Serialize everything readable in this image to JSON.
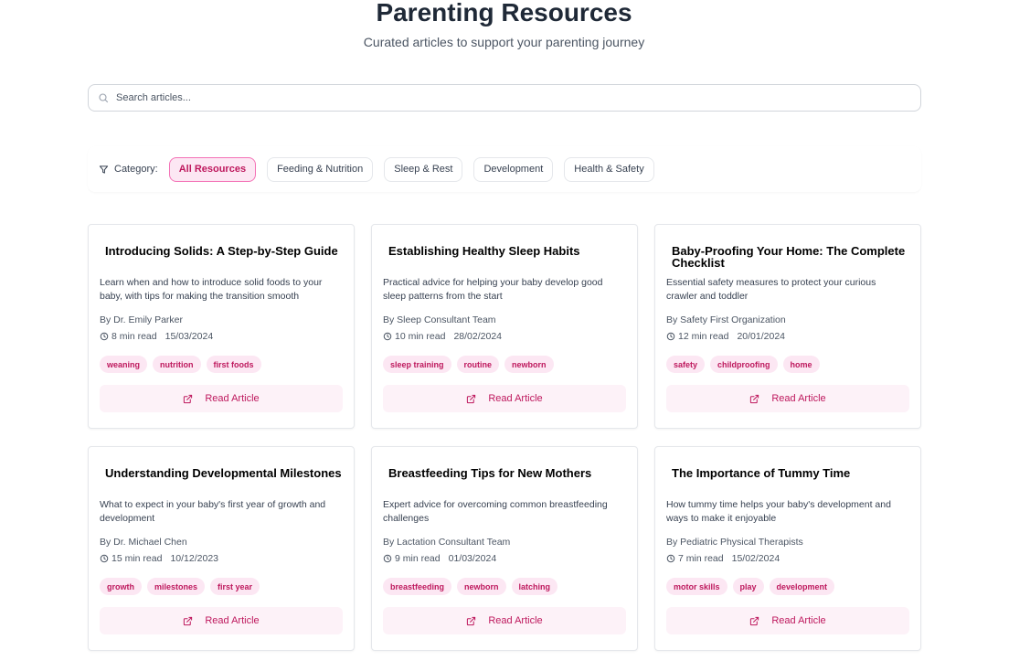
{
  "header": {
    "title": "Parenting Resources",
    "subtitle": "Curated articles to support your parenting journey"
  },
  "search": {
    "placeholder": "Search articles...",
    "value": "",
    "icon": "search-icon"
  },
  "filters": {
    "label": "Category:",
    "icon": "filter-icon",
    "chips": [
      {
        "label": "All Resources",
        "active": true
      },
      {
        "label": "Feeding & Nutrition",
        "active": false
      },
      {
        "label": "Sleep & Rest",
        "active": false
      },
      {
        "label": "Development",
        "active": false
      },
      {
        "label": "Health & Safety",
        "active": false
      }
    ]
  },
  "colors": {
    "accent": "#be185d",
    "accent_bg": "#fce7f3",
    "button_bg": "#fdf2f8"
  },
  "articles": [
    {
      "title": "Introducing Solids: A Step-by-Step Guide",
      "description": "Learn when and how to introduce solid foods to your baby, with tips for making the transition smooth",
      "author": "By Dr. Emily Parker",
      "read_time": "8 min read",
      "date": "15/03/2024",
      "tags": [
        "weaning",
        "nutrition",
        "first foods"
      ],
      "button": "Read Article"
    },
    {
      "title": "Establishing Healthy Sleep Habits",
      "description": "Practical advice for helping your baby develop good sleep patterns from the start",
      "author": "By Sleep Consultant Team",
      "read_time": "10 min read",
      "date": "28/02/2024",
      "tags": [
        "sleep training",
        "routine",
        "newborn"
      ],
      "button": "Read Article"
    },
    {
      "title": "Baby-Proofing Your Home: The Complete Checklist",
      "description": "Essential safety measures to protect your curious crawler and toddler",
      "author": "By Safety First Organization",
      "read_time": "12 min read",
      "date": "20/01/2024",
      "tags": [
        "safety",
        "childproofing",
        "home"
      ],
      "button": "Read Article"
    },
    {
      "title": "Understanding Developmental Milestones",
      "description": "What to expect in your baby's first year of growth and development",
      "author": "By Dr. Michael Chen",
      "read_time": "15 min read",
      "date": "10/12/2023",
      "tags": [
        "growth",
        "milestones",
        "first year"
      ],
      "button": "Read Article"
    },
    {
      "title": "Breastfeeding Tips for New Mothers",
      "description": "Expert advice for overcoming common breastfeeding challenges",
      "author": "By Lactation Consultant Team",
      "read_time": "9 min read",
      "date": "01/03/2024",
      "tags": [
        "breastfeeding",
        "newborn",
        "latching"
      ],
      "button": "Read Article"
    },
    {
      "title": "The Importance of Tummy Time",
      "description": "How tummy time helps your baby's development and ways to make it enjoyable",
      "author": "By Pediatric Physical Therapists",
      "read_time": "7 min read",
      "date": "15/02/2024",
      "tags": [
        "motor skills",
        "play",
        "development"
      ],
      "button": "Read Article"
    }
  ]
}
